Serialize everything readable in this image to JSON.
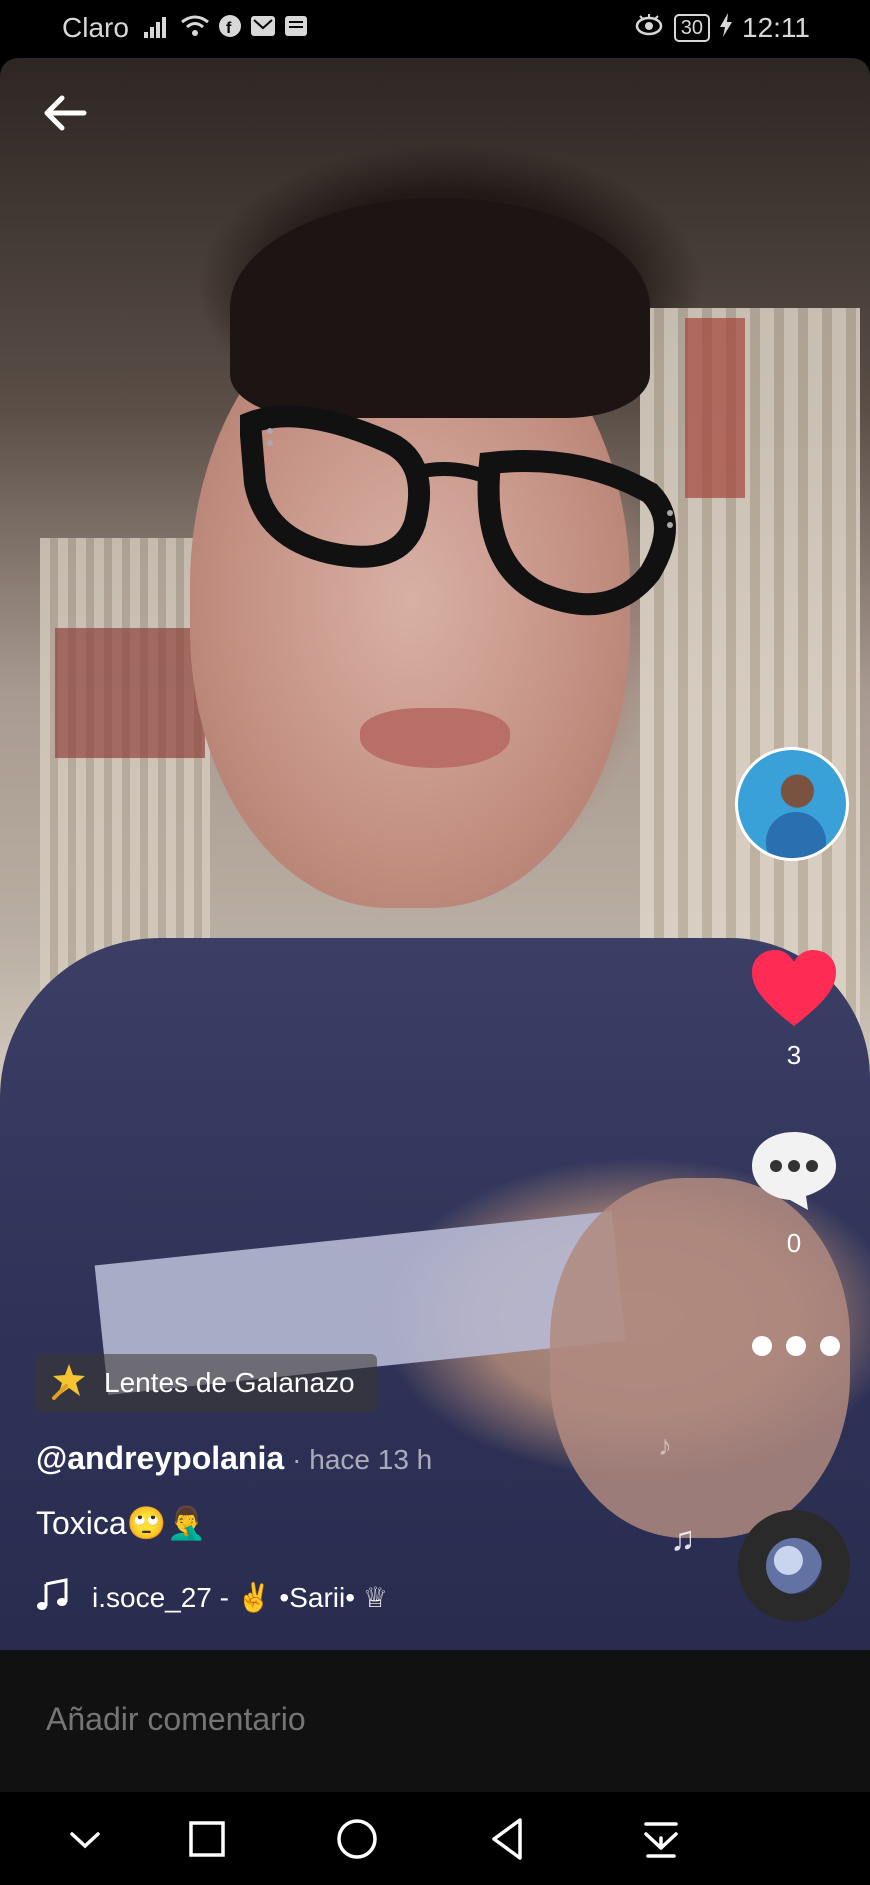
{
  "status_bar": {
    "carrier": "Claro",
    "battery": "30",
    "time": "12:11"
  },
  "video": {
    "effect_label": "Lentes de Galanazo",
    "author": "@andreypolania",
    "time_ago": "· hace 13 h",
    "caption": "Toxica🙄🤦‍♂️",
    "sound": "i.soce_27 - ✌️ •Sarii• ♕"
  },
  "actions": {
    "likes": "3",
    "comments": "0"
  },
  "comment_bar": {
    "placeholder": "Añadir comentario"
  },
  "colors": {
    "like": "#fe2c55",
    "background": "#000000",
    "comment_bar": "#111111"
  },
  "icons": [
    "back-arrow-icon",
    "heart-icon",
    "comment-bubble-icon",
    "more-dots-icon",
    "music-note-icon",
    "sparkle-wand-icon"
  ]
}
